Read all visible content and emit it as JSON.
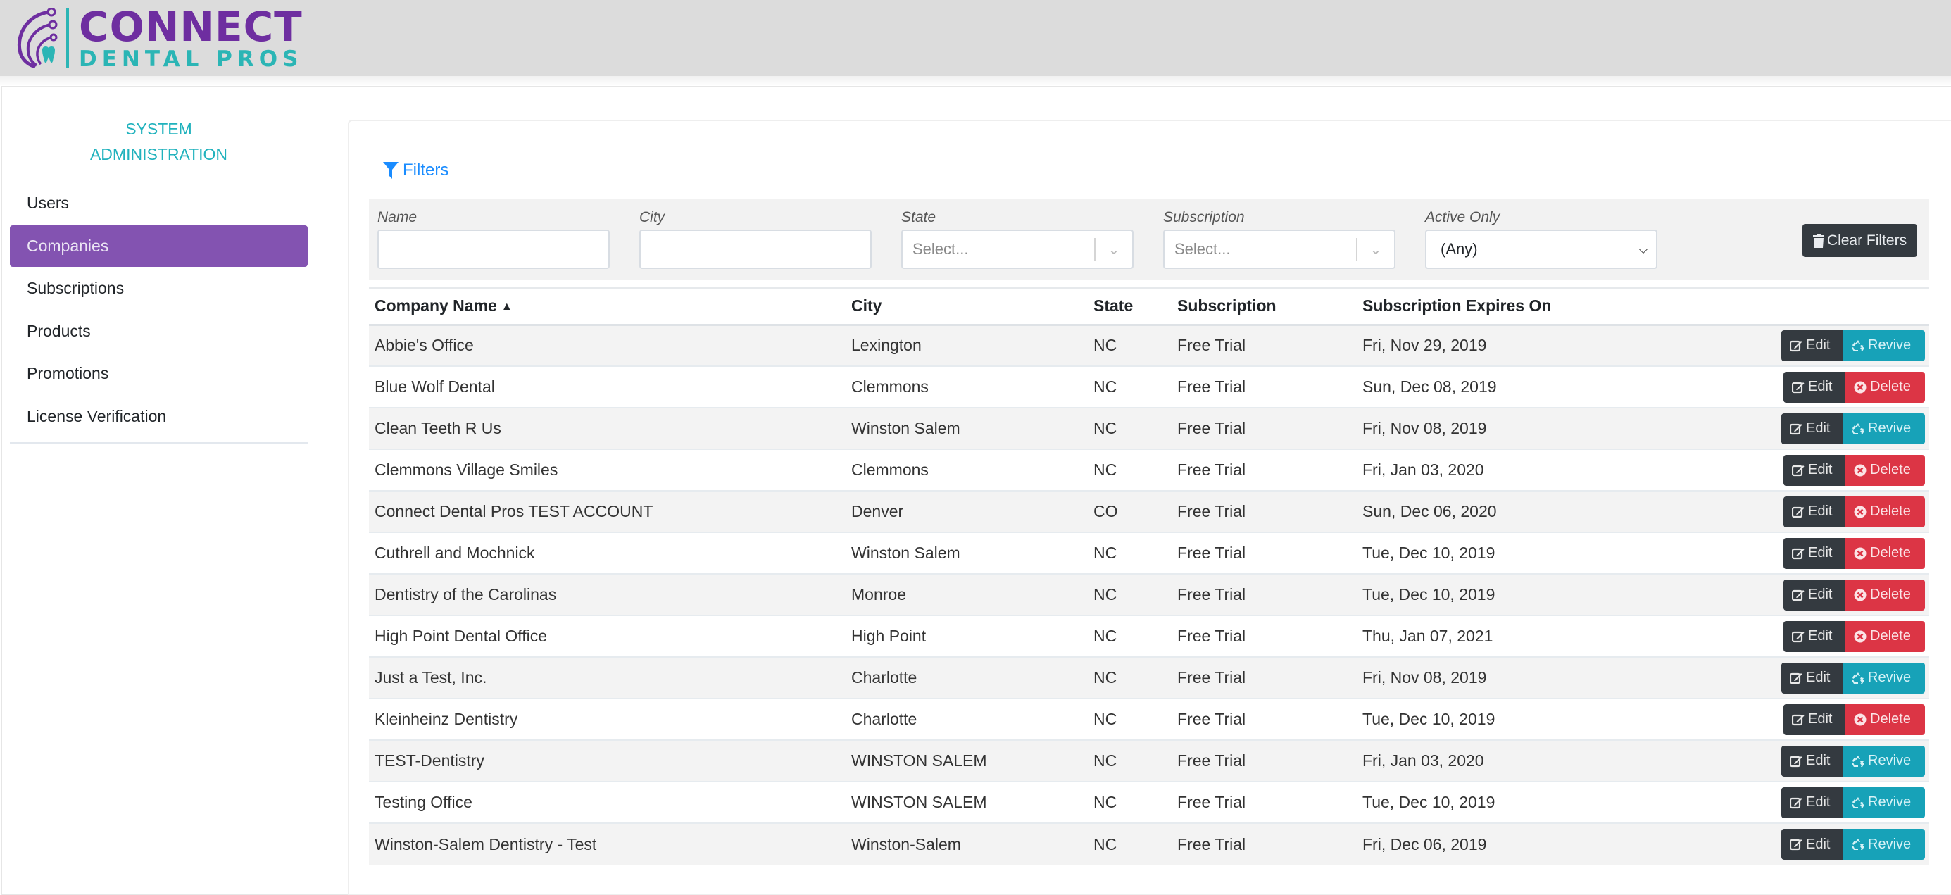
{
  "header": {
    "logo_main": "CONNECT",
    "logo_sub": "DENTAL PROS"
  },
  "colors": {
    "brand_purple": "#6e2ea0",
    "brand_teal": "#2bb5b5",
    "nav_active": "#8353b1",
    "link_blue": "#1a8cff",
    "btn_dark": "#343a40",
    "btn_revive": "#17a2b8",
    "btn_delete": "#dc3545"
  },
  "sidebar": {
    "title_line1": "SYSTEM",
    "title_line2": "ADMINISTRATION",
    "items": [
      {
        "label": "Users",
        "active": false
      },
      {
        "label": "Companies",
        "active": true
      },
      {
        "label": "Subscriptions",
        "active": false
      },
      {
        "label": "Products",
        "active": false
      },
      {
        "label": "Promotions",
        "active": false
      },
      {
        "label": "License Verification",
        "active": false
      }
    ]
  },
  "filters": {
    "toggle_label": "Filters",
    "name": {
      "label": "Name",
      "value": ""
    },
    "city": {
      "label": "City",
      "value": ""
    },
    "state": {
      "label": "State",
      "placeholder": "Select..."
    },
    "subscription": {
      "label": "Subscription",
      "placeholder": "Select..."
    },
    "active_only": {
      "label": "Active Only",
      "value": "(Any)"
    },
    "clear_label": "Clear Filters"
  },
  "table": {
    "columns": [
      "Company Name",
      "City",
      "State",
      "Subscription",
      "Subscription Expires On"
    ],
    "sort_column": "Company Name",
    "sort_direction": "ascending",
    "edit_label": "Edit",
    "revive_label": "Revive",
    "delete_label": "Delete",
    "rows": [
      {
        "name": "Abbie's Office",
        "city": "Lexington",
        "state": "NC",
        "subscription": "Free Trial",
        "expires": "Fri, Nov 29, 2019",
        "action": "revive"
      },
      {
        "name": "Blue Wolf Dental",
        "city": "Clemmons",
        "state": "NC",
        "subscription": "Free Trial",
        "expires": "Sun, Dec 08, 2019",
        "action": "delete"
      },
      {
        "name": "Clean Teeth R Us",
        "city": "Winston Salem",
        "state": "NC",
        "subscription": "Free Trial",
        "expires": "Fri, Nov 08, 2019",
        "action": "revive"
      },
      {
        "name": "Clemmons Village Smiles",
        "city": "Clemmons",
        "state": "NC",
        "subscription": "Free Trial",
        "expires": "Fri, Jan 03, 2020",
        "action": "delete"
      },
      {
        "name": "Connect Dental Pros TEST ACCOUNT",
        "city": "Denver",
        "state": "CO",
        "subscription": "Free Trial",
        "expires": "Sun, Dec 06, 2020",
        "action": "delete"
      },
      {
        "name": "Cuthrell and Mochnick",
        "city": "Winston Salem",
        "state": "NC",
        "subscription": "Free Trial",
        "expires": "Tue, Dec 10, 2019",
        "action": "delete"
      },
      {
        "name": "Dentistry of the Carolinas",
        "city": "Monroe",
        "state": "NC",
        "subscription": "Free Trial",
        "expires": "Tue, Dec 10, 2019",
        "action": "delete"
      },
      {
        "name": "High Point Dental Office",
        "city": "High Point",
        "state": "NC",
        "subscription": "Free Trial",
        "expires": "Thu, Jan 07, 2021",
        "action": "delete"
      },
      {
        "name": "Just a Test, Inc.",
        "city": "Charlotte",
        "state": "NC",
        "subscription": "Free Trial",
        "expires": "Fri, Nov 08, 2019",
        "action": "revive"
      },
      {
        "name": "Kleinheinz Dentistry",
        "city": "Charlotte",
        "state": "NC",
        "subscription": "Free Trial",
        "expires": "Tue, Dec 10, 2019",
        "action": "delete"
      },
      {
        "name": "TEST-Dentistry",
        "city": "WINSTON SALEM",
        "state": "NC",
        "subscription": "Free Trial",
        "expires": "Fri, Jan 03, 2020",
        "action": "revive"
      },
      {
        "name": "Testing Office",
        "city": "WINSTON SALEM",
        "state": "NC",
        "subscription": "Free Trial",
        "expires": "Tue, Dec 10, 2019",
        "action": "revive"
      },
      {
        "name": "Winston-Salem Dentistry - Test",
        "city": "Winston-Salem",
        "state": "NC",
        "subscription": "Free Trial",
        "expires": "Fri, Dec 06, 2019",
        "action": "revive"
      }
    ]
  }
}
